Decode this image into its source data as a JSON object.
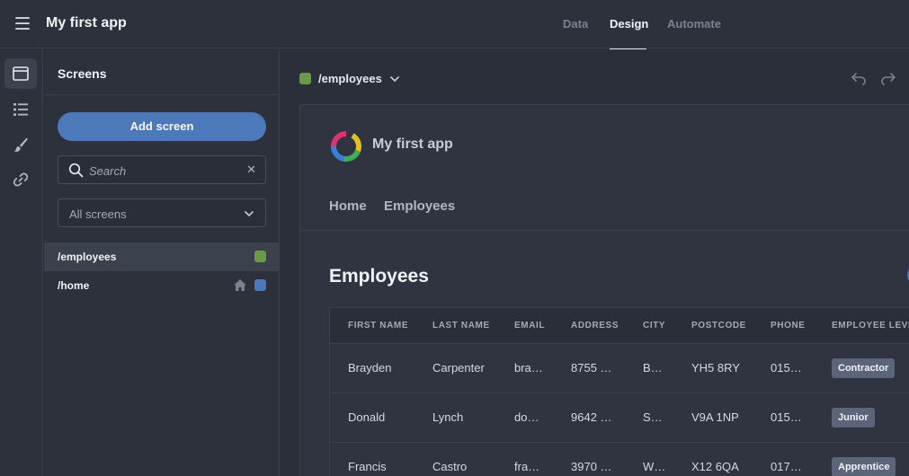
{
  "topbar": {
    "app_title": "My first app",
    "tabs": [
      {
        "label": "Data",
        "active": false
      },
      {
        "label": "Design",
        "active": true
      },
      {
        "label": "Automate",
        "active": false
      }
    ]
  },
  "rail": {
    "items": [
      {
        "icon": "screen-icon",
        "active": true
      },
      {
        "icon": "list-icon",
        "active": false
      },
      {
        "icon": "brush-icon",
        "active": false
      },
      {
        "icon": "link-icon",
        "active": false
      }
    ]
  },
  "screens_panel": {
    "title": "Screens",
    "add_button": "Add screen",
    "search": {
      "placeholder": "Search",
      "value": ""
    },
    "filter": {
      "selected": "All screens"
    },
    "items": [
      {
        "label": "/employees",
        "color": "#6a9a48",
        "home": false,
        "active": true
      },
      {
        "label": "/home",
        "color": "#4c79ba",
        "home": true,
        "active": false
      }
    ]
  },
  "main": {
    "route": {
      "label": "/employees",
      "color": "#6a9a48"
    },
    "preview": {
      "app_title": "My first app",
      "nav": [
        "Home",
        "Employees"
      ],
      "heading": "Employees",
      "table": {
        "columns": [
          "FIRST NAME",
          "LAST NAME",
          "EMAIL",
          "ADDRESS",
          "CITY",
          "POSTCODE",
          "PHONE",
          "EMPLOYEE LEVEL"
        ],
        "rows": [
          [
            "Brayden",
            "Carpenter",
            "bra…",
            "8755 …",
            "B…",
            "YH5 8RY",
            "015…",
            "Contractor"
          ],
          [
            "Donald",
            "Lynch",
            "do…",
            "9642 …",
            "S…",
            "V9A 1NP",
            "015…",
            "Junior"
          ],
          [
            "Francis",
            "Castro",
            "fra…",
            "3970 …",
            "W…",
            "X12 6QA",
            "017…",
            "Apprentice"
          ]
        ]
      }
    }
  },
  "colors": {
    "accent": "#4c79ba",
    "background": "#2b2f3a",
    "panel": "#2d313c",
    "badge": "#5b6478"
  }
}
